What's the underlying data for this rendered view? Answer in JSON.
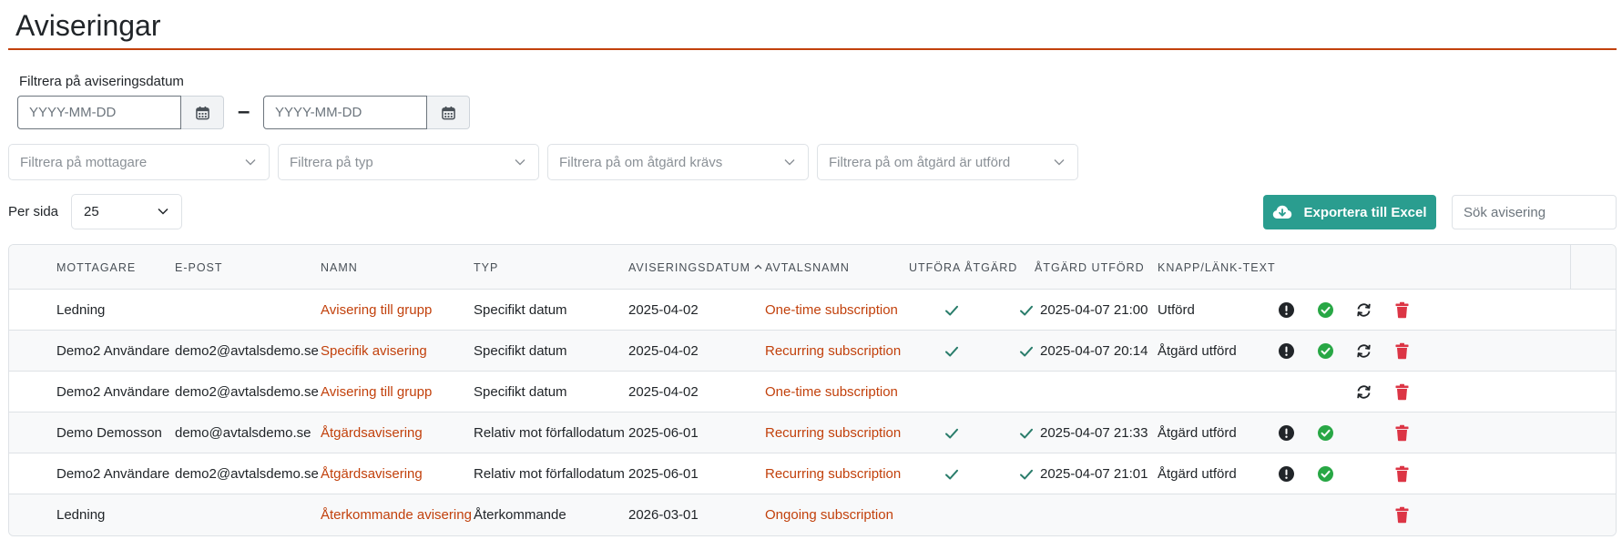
{
  "page": {
    "title": "Aviseringar"
  },
  "filters": {
    "date_label": "Filtrera på aviseringsdatum",
    "date_from_placeholder": "YYYY-MM-DD",
    "date_to_placeholder": "YYYY-MM-DD",
    "date_separator": "–",
    "recipient_placeholder": "Filtrera på mottagare",
    "type_placeholder": "Filtrera på typ",
    "action_required_placeholder": "Filtrera på om åtgärd krävs",
    "action_done_placeholder": "Filtrera på om åtgärd är utförd"
  },
  "toolbar": {
    "per_page_label": "Per sida",
    "per_page_value": "25",
    "export_label": "Exportera till Excel",
    "search_placeholder": "Sök avisering"
  },
  "colors": {
    "accent": "#c2410c",
    "export": "#2a9d8f",
    "check": "#2a7d6b",
    "success": "#28a745",
    "danger": "#dc3545"
  },
  "table": {
    "headers": [
      "Mottagare",
      "E-post",
      "Namn",
      "Typ",
      "Aviseringsdatum",
      "Avtalsnamn",
      "Utföra åtgärd",
      "Åtgärd utförd",
      "Knapp/länk-text"
    ],
    "sort_indicator": "^",
    "rows": [
      {
        "recipient": "Ledning",
        "email": "",
        "name": "Avisering till grupp",
        "type": "Specifikt datum",
        "date": "2025-04-02",
        "contract": "One-time subscription",
        "action_required": true,
        "action_done": "2025-04-07 21:00",
        "button_text": "Utförd",
        "icons": {
          "alert": true,
          "success": true,
          "sync": true,
          "trash": true
        }
      },
      {
        "recipient": "Demo2 Användare",
        "email": "demo2@avtalsdemo.se",
        "name": "Specifik avisering",
        "type": "Specifikt datum",
        "date": "2025-04-02",
        "contract": "Recurring subscription",
        "action_required": true,
        "action_done": "2025-04-07 20:14",
        "button_text": "Åtgärd utförd",
        "icons": {
          "alert": true,
          "success": true,
          "sync": true,
          "trash": true
        }
      },
      {
        "recipient": "Demo2 Användare",
        "email": "demo2@avtalsdemo.se",
        "name": "Avisering till grupp",
        "type": "Specifikt datum",
        "date": "2025-04-02",
        "contract": "One-time subscription",
        "action_required": false,
        "action_done": "",
        "button_text": "",
        "icons": {
          "alert": false,
          "success": false,
          "sync": true,
          "trash": true
        }
      },
      {
        "recipient": "Demo Demosson",
        "email": "demo@avtalsdemo.se",
        "name": "Åtgärdsavisering",
        "type": "Relativ mot förfallodatum",
        "date": "2025-06-01",
        "contract": "Recurring subscription",
        "action_required": true,
        "action_done": "2025-04-07 21:33",
        "button_text": "Åtgärd utförd",
        "icons": {
          "alert": true,
          "success": true,
          "sync": false,
          "trash": true
        }
      },
      {
        "recipient": "Demo2 Användare",
        "email": "demo2@avtalsdemo.se",
        "name": "Åtgärdsavisering",
        "type": "Relativ mot förfallodatum",
        "date": "2025-06-01",
        "contract": "Recurring subscription",
        "action_required": true,
        "action_done": "2025-04-07 21:01",
        "button_text": "Åtgärd utförd",
        "icons": {
          "alert": true,
          "success": true,
          "sync": false,
          "trash": true
        }
      },
      {
        "recipient": "Ledning",
        "email": "",
        "name": "Återkommande avisering",
        "type": "Återkommande",
        "date": "2026-03-01",
        "contract": "Ongoing subscription",
        "action_required": false,
        "action_done": "",
        "button_text": "",
        "icons": {
          "alert": false,
          "success": false,
          "sync": false,
          "trash": true
        }
      }
    ]
  }
}
